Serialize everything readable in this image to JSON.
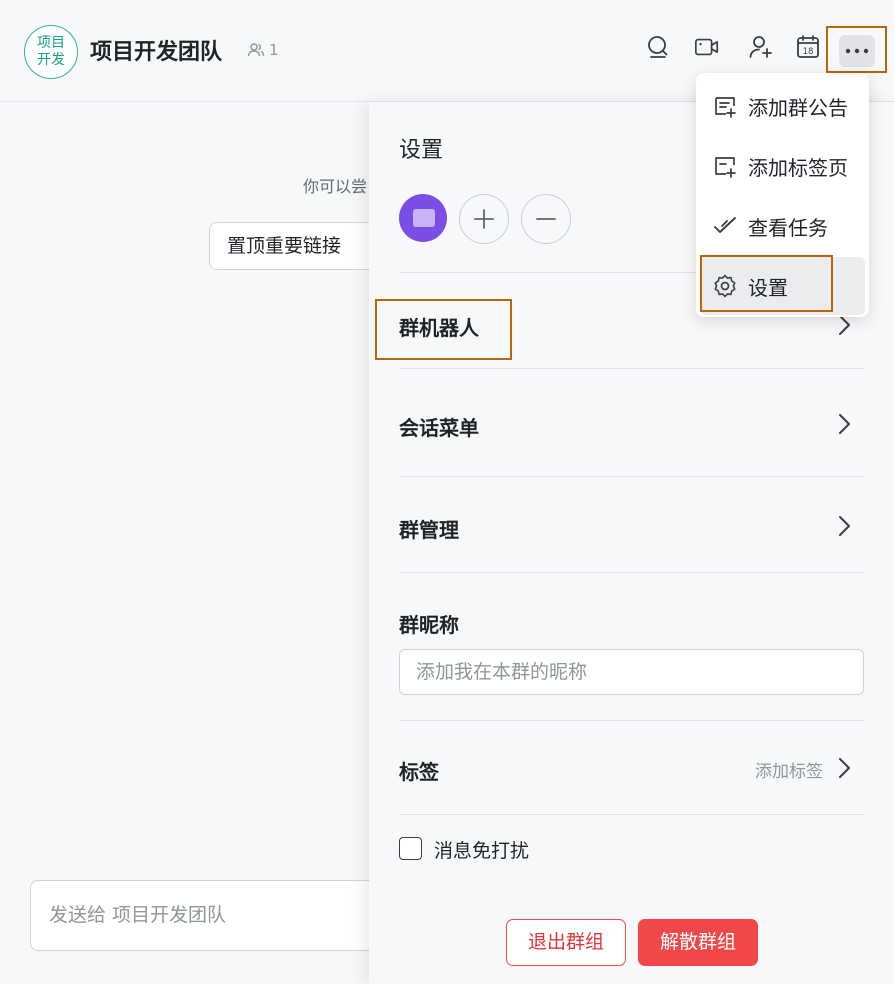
{
  "header": {
    "avatar_text_line1": "项目",
    "avatar_text_line2": "开发",
    "title": "项目开发团队",
    "member_count": "1",
    "icons": [
      "search-icon",
      "video-call-icon",
      "add-member-icon",
      "calendar-icon",
      "more-icon"
    ],
    "calendar_day": "18"
  },
  "chat": {
    "hint": "你可以尝",
    "pin_button_label": "置顶重要链接",
    "input_placeholder": "发送给 项目开发团队"
  },
  "settings_panel": {
    "title": "设置",
    "rows": {
      "bots": "群机器人",
      "menu": "会话菜单",
      "manage": "群管理",
      "nickname": "群昵称",
      "tags": "标签"
    },
    "nickname_placeholder": "添加我在本群的昵称",
    "add_tag_label": "添加标签",
    "dnd_label": "消息免打扰",
    "dnd_checked": false,
    "leave_button": "退出群组",
    "dissolve_button": "解散群组"
  },
  "dropdown_menu": {
    "items": [
      {
        "label": "添加群公告",
        "icon": "announcement-icon"
      },
      {
        "label": "添加标签页",
        "icon": "add-tab-icon"
      },
      {
        "label": "查看任务",
        "icon": "task-check-icon"
      },
      {
        "label": "设置",
        "icon": "gear-icon"
      }
    ],
    "active_item": "设置"
  },
  "colors": {
    "accent_teal": "#2fb39a",
    "danger_red": "#f04848",
    "highlight_orange": "#b8650c",
    "member_avatar_purple": "#7b4ee6"
  }
}
